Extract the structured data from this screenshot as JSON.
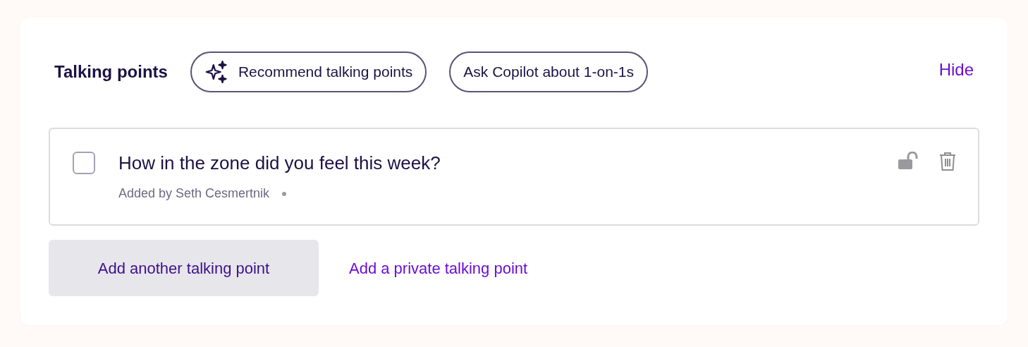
{
  "header": {
    "title": "Talking points",
    "actions": [
      {
        "label": "Recommend talking points",
        "kind": "sparkle"
      },
      {
        "label": "Ask Copilot about 1-on-1s",
        "kind": "plain"
      }
    ],
    "hide": "Hide"
  },
  "items": [
    {
      "text": "How in the zone did you feel this week?",
      "meta": "Added by Seth Cesmertnik",
      "checked": false,
      "locked": false
    }
  ],
  "footer": {
    "add": "Add another talking point",
    "add_private": "Add a private talking point"
  }
}
